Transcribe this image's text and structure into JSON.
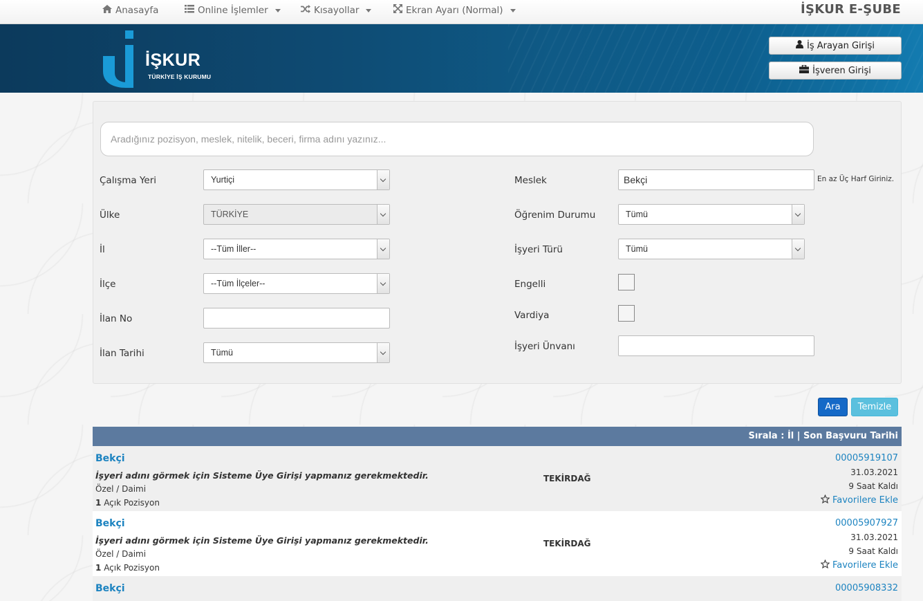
{
  "nav": {
    "home": "Anasayfa",
    "online": "Online İşlemler",
    "shortcuts": "Kısayollar",
    "screen": "Ekran Ayarı (Normal)",
    "brand": "İŞKUR E-ŞUBE"
  },
  "header": {
    "logo_word": "İŞKUR",
    "logo_sub": "TÜRKİYE İŞ KURUMU",
    "job_seeker_login": "İş Arayan Girişi",
    "employer_login": "İşveren Girişi",
    "accent": "#1a9bd7"
  },
  "search": {
    "placeholder": "Aradığınız pozisyon, meslek, nitelik, beceri, firma adını yazınız..."
  },
  "form": {
    "left": [
      {
        "label": "Çalışma Yeri",
        "value": "Yurtiçi"
      },
      {
        "label": "Ülke",
        "value": "TÜRKİYE"
      },
      {
        "label": "İl",
        "value": "--Tüm İller--"
      },
      {
        "label": "İlçe",
        "value": "--Tüm İlçeler--"
      },
      {
        "label": "İlan No",
        "value": ""
      },
      {
        "label": "İlan Tarihi",
        "value": "Tümü"
      }
    ],
    "profession": {
      "label": "Meslek",
      "value": "Bekçi",
      "hint": "En az Üç Harf Giriniz."
    },
    "education": {
      "label": "Öğrenim Durumu",
      "value": "Tümü"
    },
    "workplace_type": {
      "label": "İşyeri Türü",
      "value": "Tümü"
    },
    "disabled": {
      "label": "Engelli"
    },
    "shift": {
      "label": "Vardiya"
    },
    "workplace_title": {
      "label": "İşyeri Ünvanı",
      "value": ""
    }
  },
  "buttons": {
    "search": "Ara",
    "clear": "Temizle"
  },
  "results": {
    "sort_label": "Sırala : İl | Son Başvuru Tarihi",
    "rows": [
      {
        "title": "Bekçi",
        "note": "İşyeri adını görmek için Sisteme Üye Girişi yapmanız gerekmektedir.",
        "type": "Özel / Daimi",
        "positions": "1",
        "positions_label": "Açık Pozisyon",
        "city": "TEKİRDAĞ",
        "listing_no": "00005919107",
        "date": "31.03.2021",
        "time_left": "9 Saat Kaldı",
        "favorite": "Favorilere Ekle"
      },
      {
        "title": "Bekçi",
        "note": "İşyeri adını görmek için Sisteme Üye Girişi yapmanız gerekmektedir.",
        "type": "Özel / Daimi",
        "positions": "1",
        "positions_label": "Açık Pozisyon",
        "city": "TEKİRDAĞ",
        "listing_no": "00005907927",
        "date": "31.03.2021",
        "time_left": "9 Saat Kaldı",
        "favorite": "Favorilere Ekle"
      },
      {
        "title": "Bekçi",
        "listing_no": "00005908332"
      }
    ]
  }
}
